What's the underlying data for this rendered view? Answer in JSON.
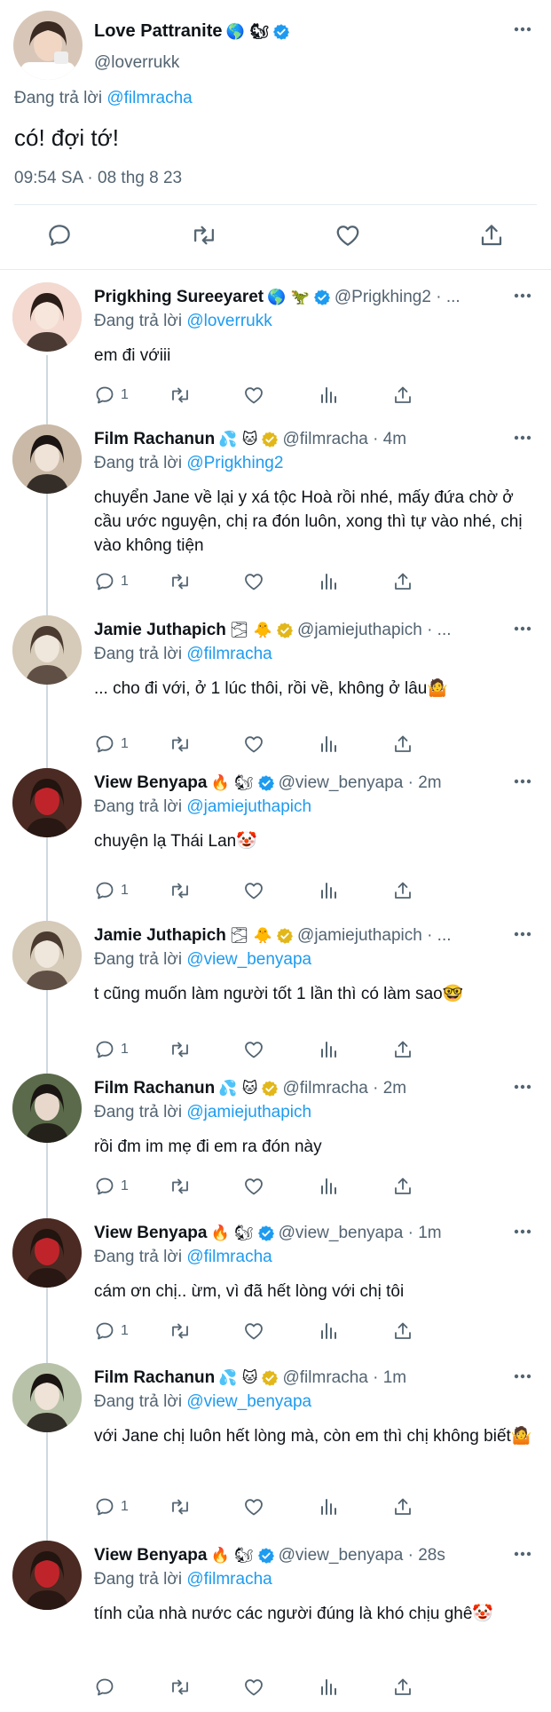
{
  "main": {
    "name": "Love Pattranite",
    "name_emoji": "🌎 🐿",
    "handle": "@loverrukk",
    "replying_prefix": "Đang trả lời",
    "replying_to": "@filmracha",
    "text": "có! đợi tớ!",
    "timestamp": "09:54 SA · 08 thg 8 23"
  },
  "replies": [
    {
      "name": "Prigkhing Sureeyaret",
      "name_emoji": "🌎 🦖",
      "handle_time": "@Prigkhing2 · ...",
      "replying_prefix": "Đang trả lời",
      "replying_to": "@loverrukk",
      "text": "em đi vớiii",
      "reply_count": "1",
      "verified_color": "#1d9bf0"
    },
    {
      "name": "Film Rachanun",
      "name_emoji": "💦 🐱",
      "handle_time": "@filmracha · 4m",
      "replying_prefix": "Đang trả lời",
      "replying_to": "@Prigkhing2",
      "text": "chuyển Jane về lại y xá tộc Hoà rồi nhé, mấy đứa chờ ở cầu ước nguyện, chị ra đón luôn, xong thì tự vào nhé, chị vào không tiện",
      "reply_count": "1",
      "verified_color": "#e2b719"
    },
    {
      "name": "Jamie Juthapich",
      "name_emoji": "🌫 🐥",
      "handle_time": "@jamiejuthapich · ...",
      "replying_prefix": "Đang trả lời",
      "replying_to": "@filmracha",
      "text": "... cho đi với, ở 1 lúc thôi, rồi về, không ở lâu🤷",
      "reply_count": "1",
      "verified_color": "#e2b719"
    },
    {
      "name": "View Benyapa",
      "name_emoji": "🔥 🐿",
      "handle_time": "@view_benyapa · 2m",
      "replying_prefix": "Đang trả lời",
      "replying_to": "@jamiejuthapich",
      "text": "chuyện lạ Thái Lan🤡",
      "reply_count": "1",
      "verified_color": "#1d9bf0"
    },
    {
      "name": "Jamie Juthapich",
      "name_emoji": "🌫 🐥",
      "handle_time": "@jamiejuthapich · ...",
      "replying_prefix": "Đang trả lời",
      "replying_to": "@view_benyapa",
      "text": "t cũng muốn làm người tốt 1 lần thì có làm sao🤓",
      "reply_count": "1",
      "verified_color": "#e2b719"
    },
    {
      "name": "Film Rachanun",
      "name_emoji": "💦 🐱",
      "handle_time": "@filmracha · 2m",
      "replying_prefix": "Đang trả lời",
      "replying_to": "@jamiejuthapich",
      "text": "rồi đm im mẹ đi em ra đón này",
      "reply_count": "1",
      "verified_color": "#e2b719"
    },
    {
      "name": "View Benyapa",
      "name_emoji": "🔥 🐿",
      "handle_time": "@view_benyapa · 1m",
      "replying_prefix": "Đang trả lời",
      "replying_to": "@filmracha",
      "text": "cám ơn chị.. ừm, vì đã hết lòng với chị tôi",
      "reply_count": "1",
      "verified_color": "#1d9bf0"
    },
    {
      "name": "Film Rachanun",
      "name_emoji": "💦 🐱",
      "handle_time": "@filmracha · 1m",
      "replying_prefix": "Đang trả lời",
      "replying_to": "@view_benyapa",
      "text": "với Jane chị luôn hết lòng mà, còn em thì chị không biết🤷",
      "reply_count": "1",
      "verified_color": "#e2b719"
    },
    {
      "name": "View Benyapa",
      "name_emoji": "🔥 🐿",
      "handle_time": "@view_benyapa · 28s",
      "replying_prefix": "Đang trả lời",
      "replying_to": "@filmracha",
      "text": "tính của nhà nước các người đúng là khó chịu ghê🤡",
      "reply_count": "",
      "verified_color": "#1d9bf0"
    }
  ],
  "icons": {
    "reply": "reply-icon",
    "retweet": "retweet-icon",
    "like": "like-icon",
    "views": "views-icon",
    "share": "share-icon",
    "more": "more-icon",
    "verified": "verified-badge-icon"
  },
  "colors": {
    "accent": "#1d9bf0",
    "text": "#0f1419",
    "muted": "#536471",
    "gold": "#e2b719"
  }
}
